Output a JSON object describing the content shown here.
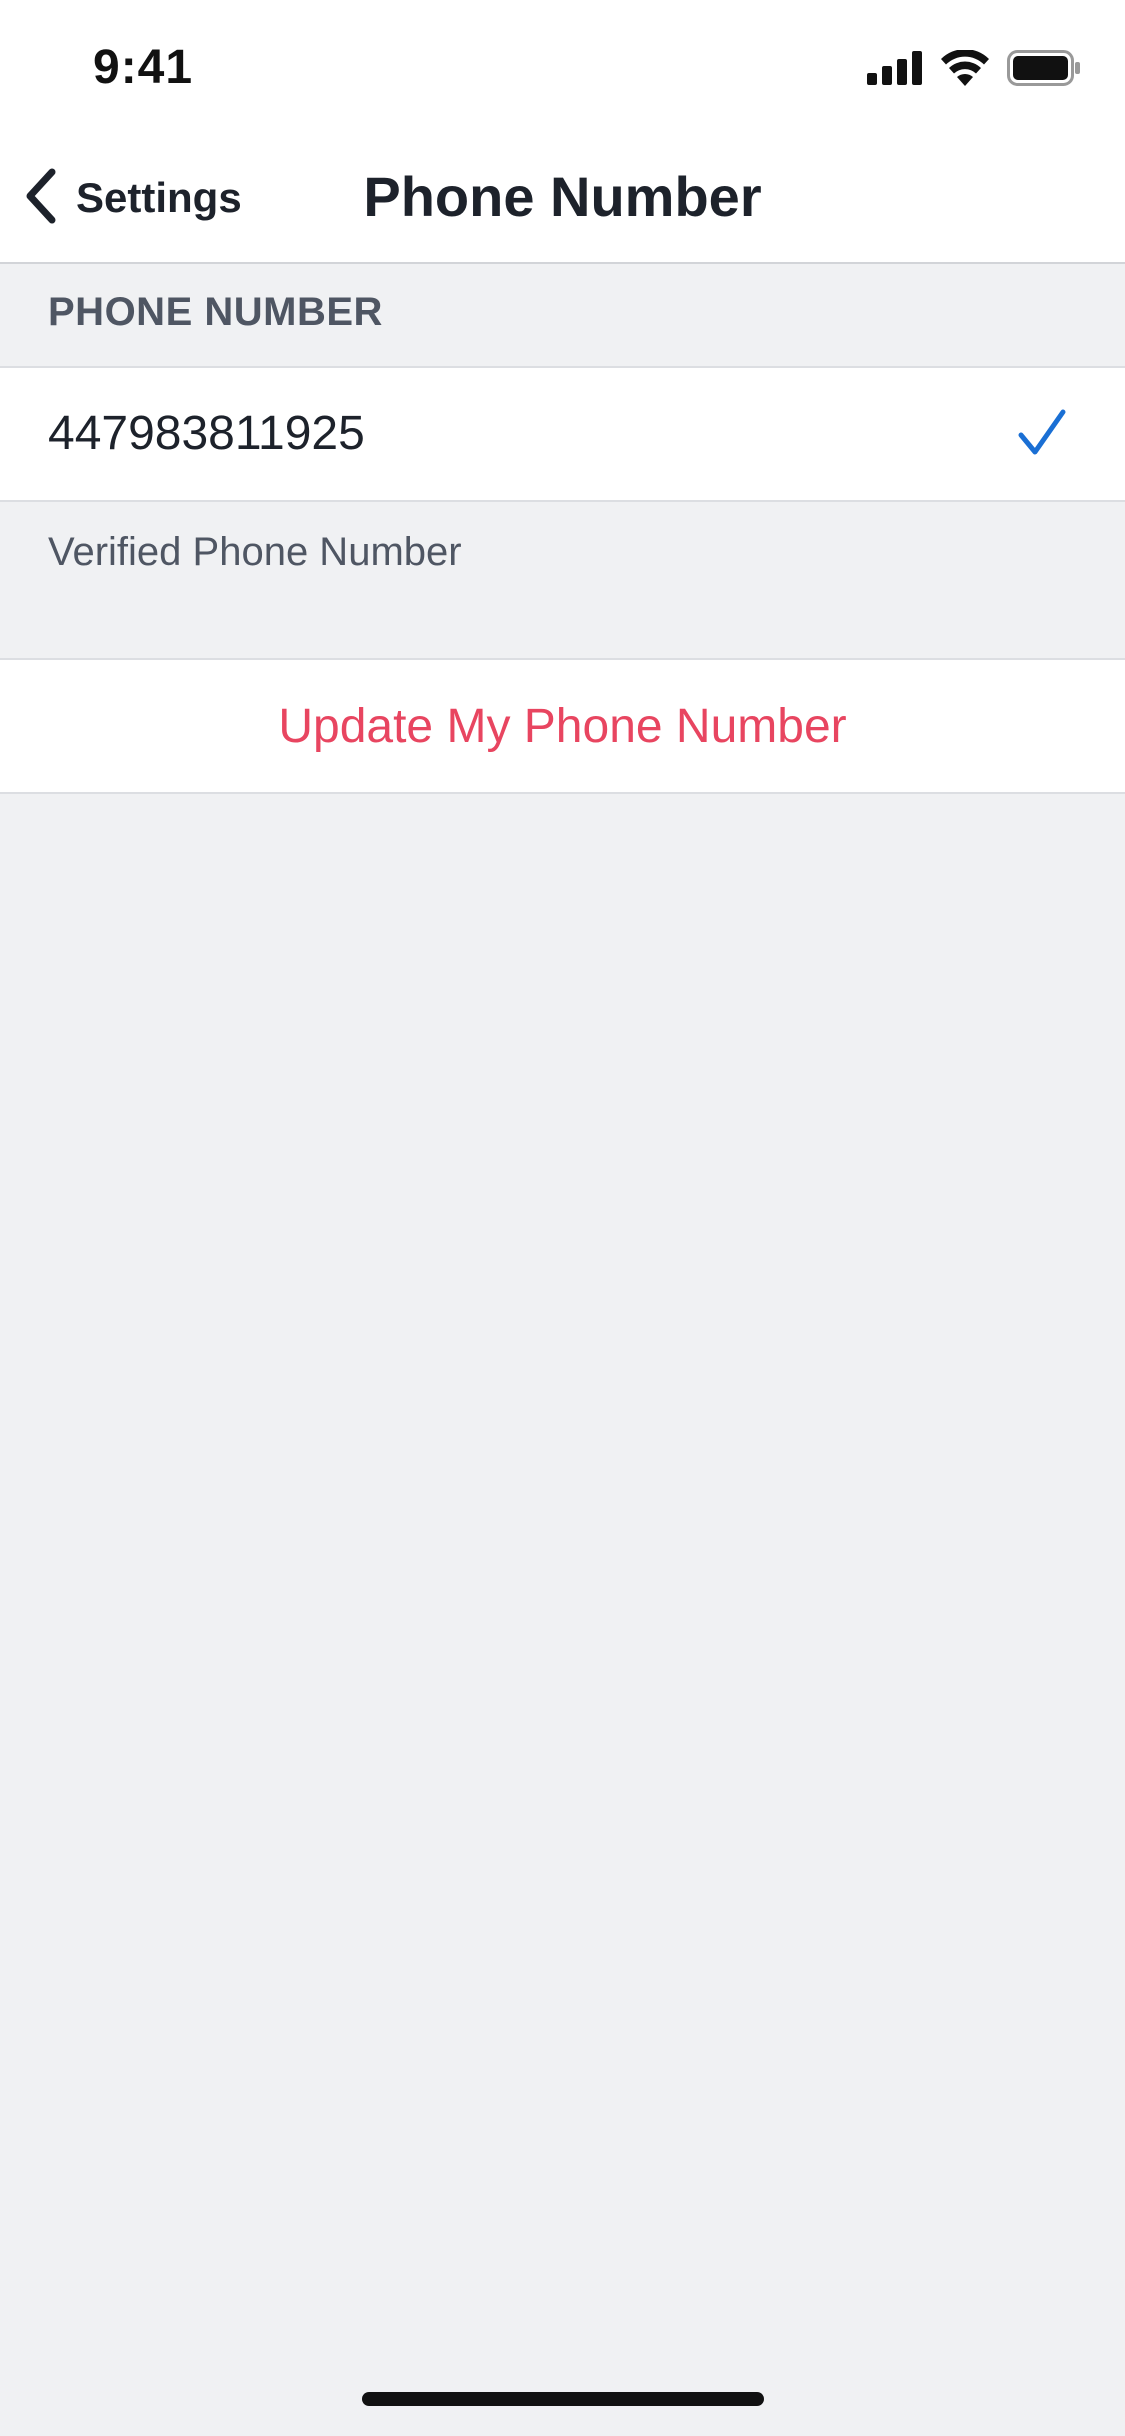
{
  "status_bar": {
    "time": "9:41",
    "icons": [
      "cellular-signal-icon",
      "wifi-icon",
      "battery-icon"
    ]
  },
  "nav": {
    "back_label": "Settings",
    "back_icon": "chevron-left-icon",
    "title": "Phone Number"
  },
  "section": {
    "header": "PHONE NUMBER",
    "phone_number": "447983811925",
    "status_icon": "checkmark-icon",
    "footer": "Verified Phone Number"
  },
  "actions": {
    "update_label": "Update My Phone Number"
  },
  "colors": {
    "accent_blue": "#1a6fd4",
    "destructive_red": "#e84560",
    "background": "#f0f1f3",
    "text_primary": "#1d222b",
    "text_secondary": "#4f5663"
  }
}
